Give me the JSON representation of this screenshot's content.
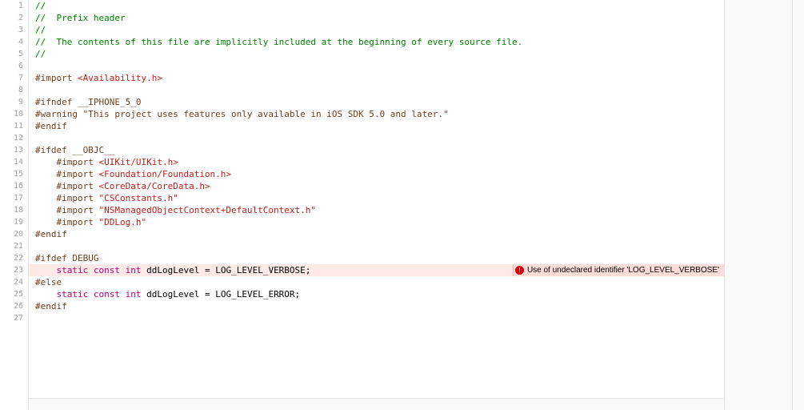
{
  "error": {
    "line": 23,
    "symbol": "!",
    "message": "Use of undeclared identifier 'LOG_LEVEL_VERBOSE'"
  },
  "lines": [
    {
      "n": 1,
      "segs": [
        {
          "c": "c-comment",
          "t": "//"
        }
      ]
    },
    {
      "n": 2,
      "segs": [
        {
          "c": "c-comment",
          "t": "//  Prefix header"
        }
      ]
    },
    {
      "n": 3,
      "segs": [
        {
          "c": "c-comment",
          "t": "//"
        }
      ]
    },
    {
      "n": 4,
      "segs": [
        {
          "c": "c-comment",
          "t": "//  The contents of this file are implicitly included at the beginning of every source file."
        }
      ]
    },
    {
      "n": 5,
      "segs": [
        {
          "c": "c-comment",
          "t": "//"
        }
      ]
    },
    {
      "n": 6,
      "segs": []
    },
    {
      "n": 7,
      "segs": [
        {
          "c": "c-pre",
          "t": "#import "
        },
        {
          "c": "c-string",
          "t": "<Availability.h>"
        }
      ]
    },
    {
      "n": 8,
      "segs": []
    },
    {
      "n": 9,
      "segs": [
        {
          "c": "c-pre",
          "t": "#ifndef "
        },
        {
          "c": "c-preid",
          "t": "__IPHONE_5_0"
        }
      ]
    },
    {
      "n": 10,
      "segs": [
        {
          "c": "c-pre",
          "t": "#warning "
        },
        {
          "c": "c-preid",
          "t": "\"This project uses features only available in iOS SDK 5.0 and later.\""
        }
      ]
    },
    {
      "n": 11,
      "segs": [
        {
          "c": "c-pre",
          "t": "#endif"
        }
      ]
    },
    {
      "n": 12,
      "segs": []
    },
    {
      "n": 13,
      "segs": [
        {
          "c": "c-pre",
          "t": "#ifdef "
        },
        {
          "c": "c-preid",
          "t": "__OBJC__"
        }
      ]
    },
    {
      "n": 14,
      "segs": [
        {
          "c": "c-plain",
          "t": "    "
        },
        {
          "c": "c-pre",
          "t": "#import "
        },
        {
          "c": "c-string",
          "t": "<UIKit/UIKit.h>"
        }
      ]
    },
    {
      "n": 15,
      "segs": [
        {
          "c": "c-plain",
          "t": "    "
        },
        {
          "c": "c-pre",
          "t": "#import "
        },
        {
          "c": "c-string",
          "t": "<Foundation/Foundation.h>"
        }
      ]
    },
    {
      "n": 16,
      "segs": [
        {
          "c": "c-plain",
          "t": "    "
        },
        {
          "c": "c-pre",
          "t": "#import "
        },
        {
          "c": "c-string",
          "t": "<CoreData/CoreData.h>"
        }
      ]
    },
    {
      "n": 17,
      "segs": [
        {
          "c": "c-plain",
          "t": "    "
        },
        {
          "c": "c-pre",
          "t": "#import "
        },
        {
          "c": "c-string",
          "t": "\"CSConstants.h\""
        }
      ]
    },
    {
      "n": 18,
      "segs": [
        {
          "c": "c-plain",
          "t": "    "
        },
        {
          "c": "c-pre",
          "t": "#import "
        },
        {
          "c": "c-string",
          "t": "\"NSManagedObjectContext+DefaultContext.h\""
        }
      ]
    },
    {
      "n": 19,
      "segs": [
        {
          "c": "c-plain",
          "t": "    "
        },
        {
          "c": "c-pre",
          "t": "#import "
        },
        {
          "c": "c-string",
          "t": "\"DDLog.h\""
        }
      ]
    },
    {
      "n": 20,
      "segs": [
        {
          "c": "c-pre",
          "t": "#endif"
        }
      ]
    },
    {
      "n": 21,
      "segs": []
    },
    {
      "n": 22,
      "segs": [
        {
          "c": "c-pre",
          "t": "#ifdef "
        },
        {
          "c": "c-preid",
          "t": "DEBUG"
        }
      ]
    },
    {
      "n": 23,
      "error": true,
      "segs": [
        {
          "c": "c-plain",
          "t": "    "
        },
        {
          "c": "c-keyword",
          "t": "static"
        },
        {
          "c": "c-plain",
          "t": " "
        },
        {
          "c": "c-keyword",
          "t": "const"
        },
        {
          "c": "c-plain",
          "t": " "
        },
        {
          "c": "c-type",
          "t": "int"
        },
        {
          "c": "c-plain",
          "t": " ddLogLevel = LOG_LEVEL_VERBOSE;"
        }
      ]
    },
    {
      "n": 24,
      "segs": [
        {
          "c": "c-pre",
          "t": "#else"
        }
      ]
    },
    {
      "n": 25,
      "segs": [
        {
          "c": "c-plain",
          "t": "    "
        },
        {
          "c": "c-keyword",
          "t": "static"
        },
        {
          "c": "c-plain",
          "t": " "
        },
        {
          "c": "c-keyword",
          "t": "const"
        },
        {
          "c": "c-plain",
          "t": " "
        },
        {
          "c": "c-type",
          "t": "int"
        },
        {
          "c": "c-plain",
          "t": " ddLogLevel = LOG_LEVEL_ERROR;"
        }
      ]
    },
    {
      "n": 26,
      "segs": [
        {
          "c": "c-pre",
          "t": "#endif"
        }
      ]
    },
    {
      "n": 27,
      "segs": []
    }
  ]
}
